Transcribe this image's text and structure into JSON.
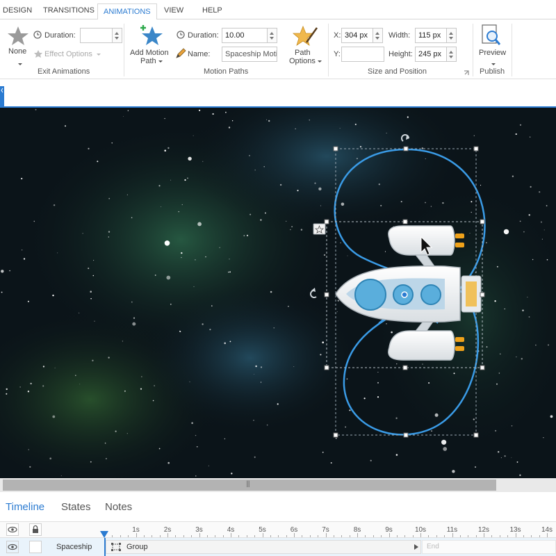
{
  "ribbon_tabs": [
    {
      "label": "DESIGN",
      "active": false
    },
    {
      "label": "TRANSITIONS",
      "active": false
    },
    {
      "label": "ANIMATIONS",
      "active": true
    },
    {
      "label": "VIEW",
      "active": false
    },
    {
      "label": "HELP",
      "active": false
    }
  ],
  "exit_animations": {
    "group_label": "Exit Animations",
    "none_label": "None",
    "duration_label": "Duration:",
    "duration_value": "",
    "effect_options_label": "Effect Options",
    "icon": "star-icon"
  },
  "motion_paths": {
    "group_label": "Motion Paths",
    "add_label_line1": "Add Motion",
    "add_label_line2": "Path",
    "duration_label": "Duration:",
    "duration_value": "10.00",
    "name_label": "Name:",
    "name_value": "Spaceship Motio",
    "path_options_line1": "Path",
    "path_options_line2": "Options"
  },
  "size_position": {
    "group_label": "Size and Position",
    "x_label": "X:",
    "x_value": "304 px",
    "y_label": "Y:",
    "y_value": "",
    "width_label": "Width:",
    "width_value": "115 px",
    "height_label": "Height:",
    "height_value": "245 px"
  },
  "publish": {
    "group_label": "Publish",
    "preview_label": "Preview"
  },
  "bottom_tabs": [
    {
      "label": "Timeline",
      "active": true
    },
    {
      "label": "States",
      "active": false
    },
    {
      "label": "Notes",
      "active": false
    }
  ],
  "timeline": {
    "ticks": [
      "1s",
      "2s",
      "3s",
      "4s",
      "5s",
      "6s",
      "7s",
      "8s",
      "9s",
      "10s",
      "11s",
      "12s",
      "13s",
      "14s"
    ],
    "row": {
      "object_name": "Spaceship",
      "bar_label": "Group",
      "end_label": "End"
    }
  },
  "colors": {
    "accent": "#2b7bd1",
    "path": "#3a9be6",
    "space": "#0b1419"
  }
}
